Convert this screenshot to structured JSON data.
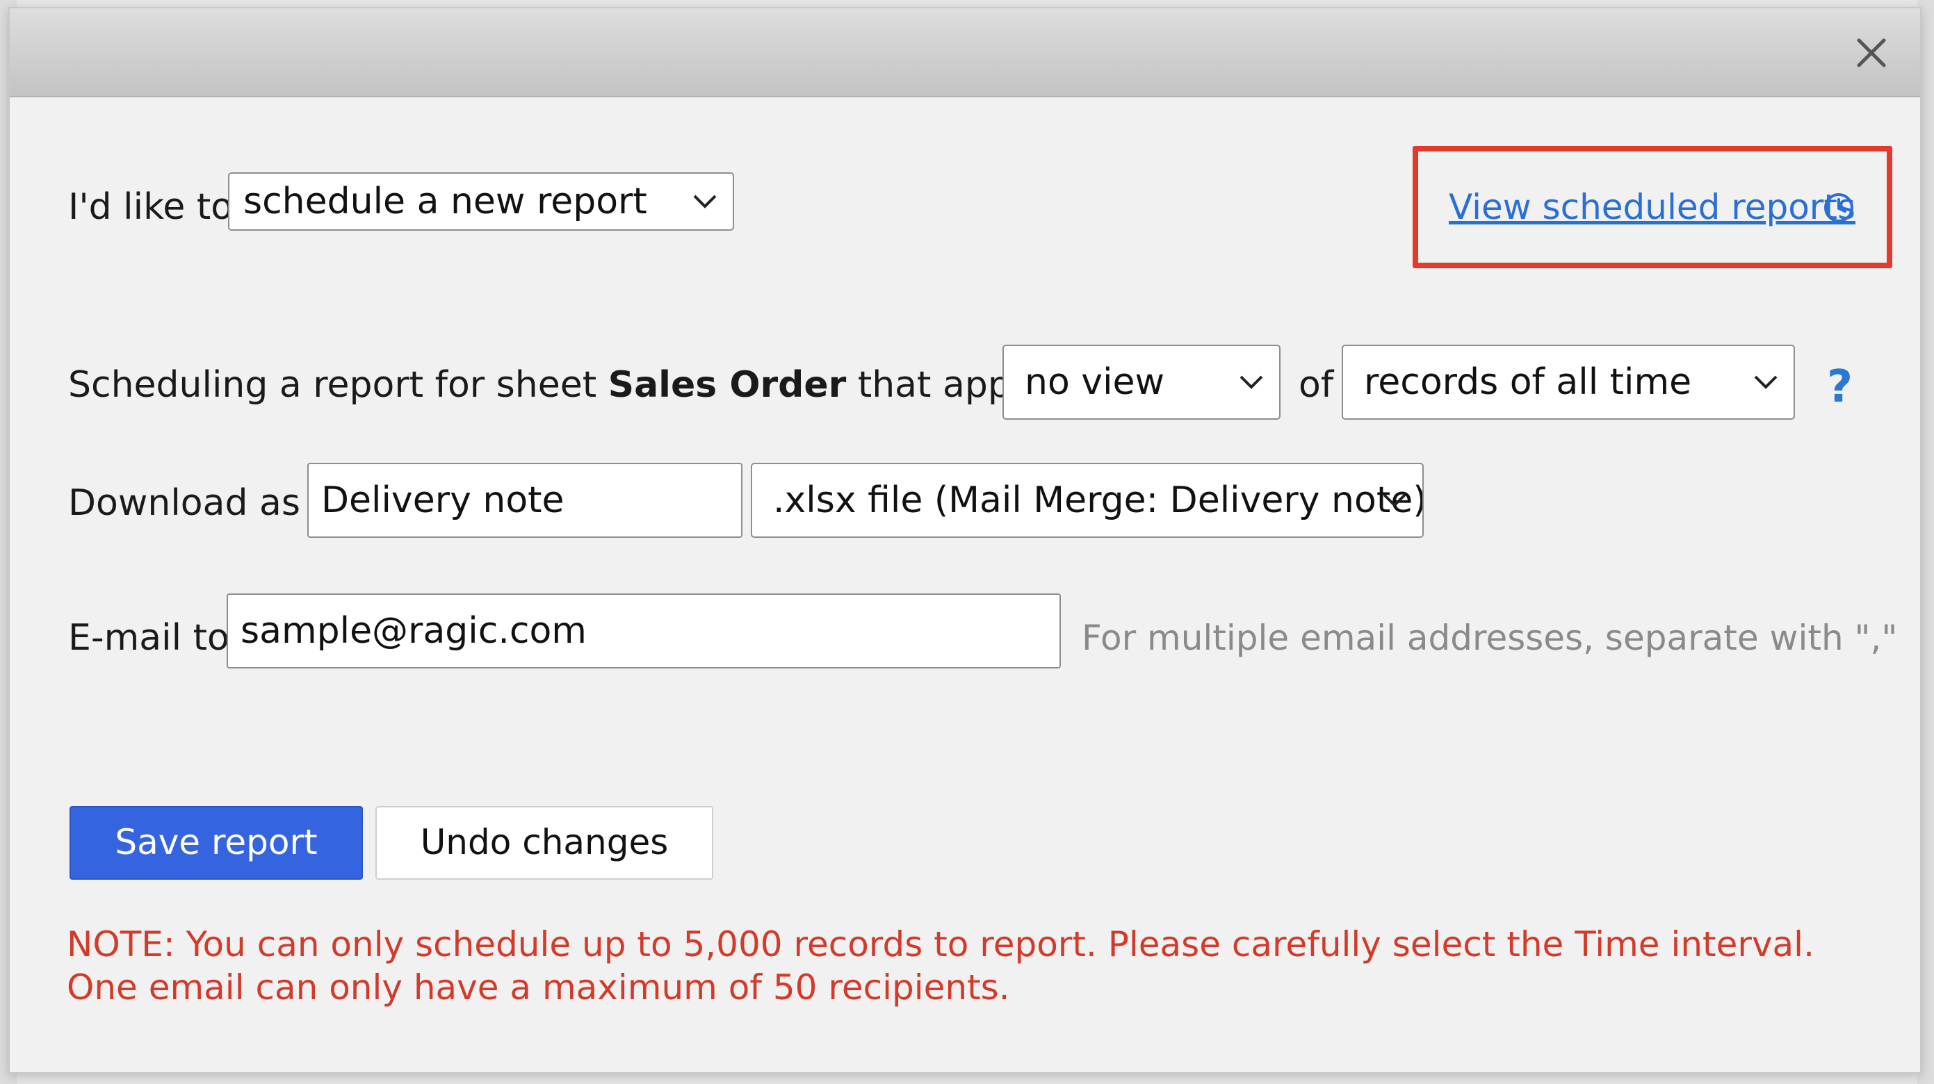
{
  "dialog": {
    "close_icon": "close-icon"
  },
  "intent": {
    "label": "I'd like to",
    "selected": "schedule a new report"
  },
  "view_link": {
    "label": "View scheduled reports",
    "icon": "clock-icon",
    "highlight_color": "#e23a2c"
  },
  "scheduling": {
    "prefix": "Scheduling a report for sheet",
    "sheet_name": "Sales Order",
    "suffix": "that applies",
    "view_selected": "no view",
    "of_label": "of",
    "range_selected": "records of all time",
    "help_icon": "?"
  },
  "download": {
    "label": "Download as",
    "filename": "Delivery note",
    "format_selected": ".xlsx file (Mail Merge: Delivery note)"
  },
  "email": {
    "label": "E-mail to",
    "value": "sample@ragic.com",
    "hint": "For multiple email addresses, separate with \",\""
  },
  "actions": {
    "save_label": "Save report",
    "undo_label": "Undo changes",
    "primary_color": "#3564e0"
  },
  "notes": {
    "line1": "NOTE: You can only schedule up to 5,000 records to report. Please carefully select the Time interval.",
    "line2": "One email can only have a maximum of 50 recipients.",
    "color": "#d23a2a"
  }
}
